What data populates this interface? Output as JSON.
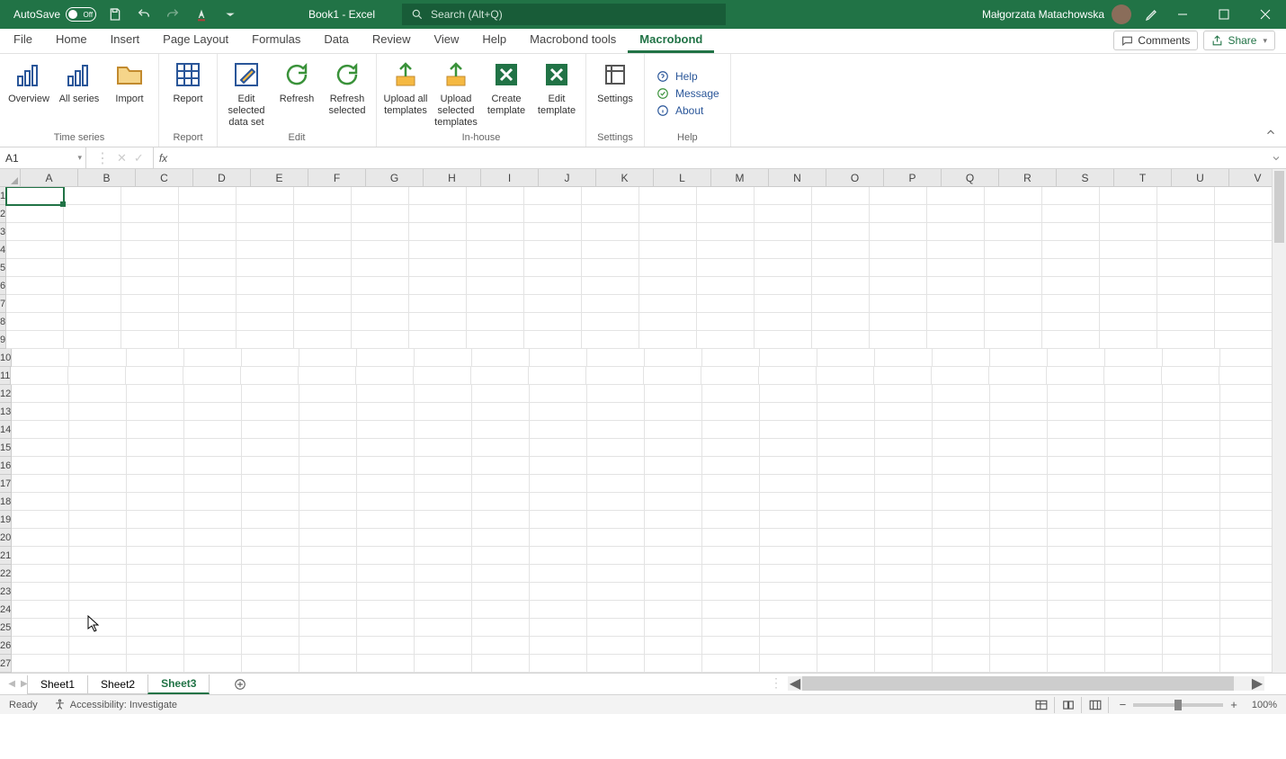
{
  "titlebar": {
    "autosave_label": "AutoSave",
    "autosave_state": "Off",
    "doc_title": "Book1 - Excel",
    "search_placeholder": "Search (Alt+Q)",
    "user_name": "Małgorzata Matachowska"
  },
  "tabs": {
    "items": [
      "File",
      "Home",
      "Insert",
      "Page Layout",
      "Formulas",
      "Data",
      "Review",
      "View",
      "Help",
      "Macrobond tools",
      "Macrobond"
    ],
    "active_index": 10,
    "comments_label": "Comments",
    "share_label": "Share"
  },
  "ribbon": {
    "groups": [
      {
        "label": "Time series",
        "buttons": [
          {
            "label": "Overview",
            "icon": "chart"
          },
          {
            "label": "All series",
            "icon": "chart"
          },
          {
            "label": "Import",
            "icon": "folder"
          }
        ]
      },
      {
        "label": "Report",
        "buttons": [
          {
            "label": "Report",
            "icon": "grid"
          }
        ]
      },
      {
        "label": "Edit",
        "buttons": [
          {
            "label": "Edit selected data set",
            "icon": "edit"
          },
          {
            "label": "Refresh",
            "icon": "refresh"
          },
          {
            "label": "Refresh selected",
            "icon": "refresh"
          }
        ]
      },
      {
        "label": "In-house",
        "buttons": [
          {
            "label": "Upload all templates",
            "icon": "upload"
          },
          {
            "label": "Upload selected templates",
            "icon": "upload"
          },
          {
            "label": "Create template",
            "icon": "excel"
          },
          {
            "label": "Edit template",
            "icon": "excel"
          }
        ]
      },
      {
        "label": "Settings",
        "buttons": [
          {
            "label": "Settings",
            "icon": "settings"
          }
        ]
      },
      {
        "label": "Help",
        "small_items": [
          {
            "label": "Help",
            "icon": "help"
          },
          {
            "label": "Message",
            "icon": "check"
          },
          {
            "label": "About",
            "icon": "info"
          }
        ]
      }
    ]
  },
  "formula_bar": {
    "name_box": "A1",
    "formula": ""
  },
  "grid": {
    "columns": [
      "A",
      "B",
      "C",
      "D",
      "E",
      "F",
      "G",
      "H",
      "I",
      "J",
      "K",
      "L",
      "M",
      "N",
      "O",
      "P",
      "Q",
      "R",
      "S",
      "T",
      "U",
      "V"
    ],
    "row_count": 27,
    "selected": "A1"
  },
  "sheet_tabs": {
    "items": [
      "Sheet1",
      "Sheet2",
      "Sheet3"
    ],
    "active_index": 2
  },
  "status": {
    "ready": "Ready",
    "accessibility": "Accessibility: Investigate",
    "zoom": "100%"
  }
}
